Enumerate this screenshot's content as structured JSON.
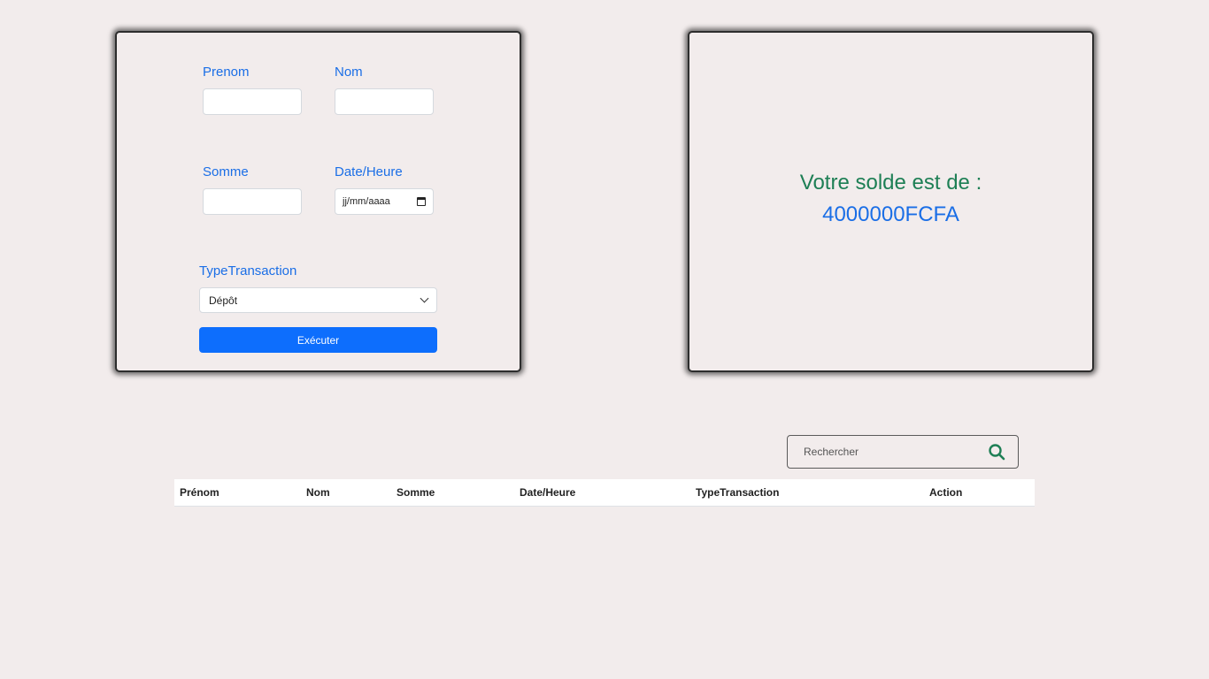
{
  "form": {
    "prenom_label": "Prenom",
    "prenom_value": "",
    "nom_label": "Nom",
    "nom_value": "",
    "somme_label": "Somme",
    "somme_value": "",
    "date_label": "Date/Heure",
    "date_placeholder": "jj/mm/aaaa",
    "type_label": "TypeTransaction",
    "type_selected": "Dépôt",
    "submit_label": "Exécuter"
  },
  "balance": {
    "label": "Votre solde est de :",
    "amount": "4000000FCFA"
  },
  "search": {
    "placeholder": "Rechercher",
    "icon": "search-icon"
  },
  "table": {
    "columns": [
      "Prénom",
      "Nom",
      "Somme",
      "Date/Heure",
      "TypeTransaction",
      "Action"
    ],
    "rows": []
  },
  "colors": {
    "background": "#f2ecec",
    "label_blue": "#1a6ee6",
    "button_blue": "#0d6efd",
    "balance_green": "#1e7f55",
    "search_icon_green": "#1e7f55"
  }
}
